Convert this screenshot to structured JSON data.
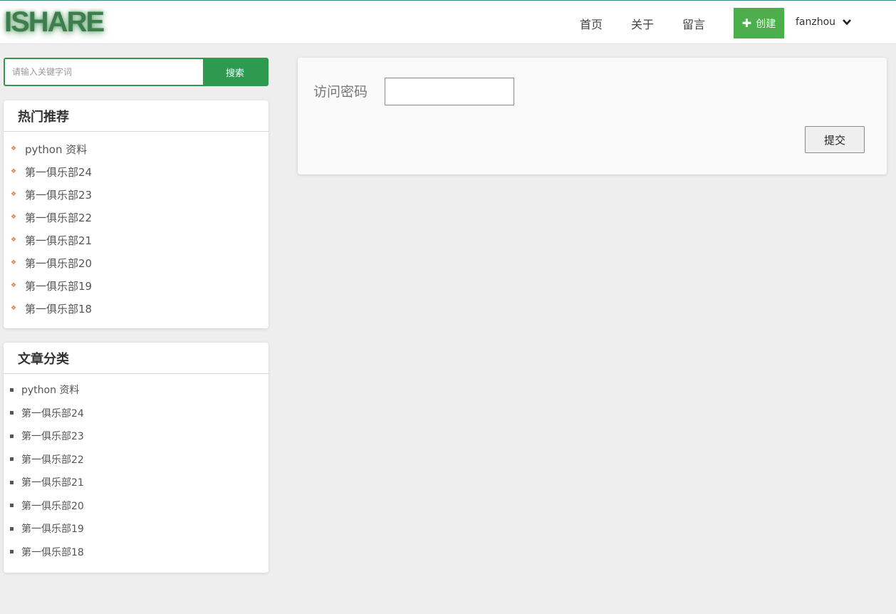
{
  "header": {
    "logo": "ISHARE",
    "nav": [
      "首页",
      "关于",
      "留言"
    ],
    "create_label": "创建",
    "username": "fanzhou",
    "accent_color": "#4cae4c"
  },
  "search": {
    "placeholder": "请输入关键字词",
    "button_label": "搜索"
  },
  "hot": {
    "title": "热门推荐",
    "items": [
      "python 资料",
      "第一俱乐部24",
      "第一俱乐部23",
      "第一俱乐部22",
      "第一俱乐部21",
      "第一俱乐部20",
      "第一俱乐部19",
      "第一俱乐部18"
    ]
  },
  "categories": {
    "title": "文章分类",
    "items": [
      "python 资料",
      "第一俱乐部24",
      "第一俱乐部23",
      "第一俱乐部22",
      "第一俱乐部21",
      "第一俱乐部20",
      "第一俱乐部19",
      "第一俱乐部18"
    ]
  },
  "form": {
    "label": "访问密码",
    "password_value": "",
    "submit_label": "提交"
  }
}
